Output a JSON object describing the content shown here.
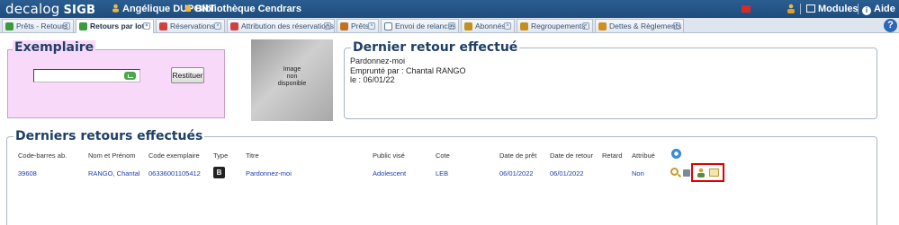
{
  "app": {
    "logo_main": "decalog",
    "logo_brand": "SIGB",
    "user": "Angélique DUPONT",
    "library": "Bibliothèque Cendrars",
    "modules_label": "Modules",
    "help_label": "Aide",
    "help_tab_icon": "?"
  },
  "tabs": [
    {
      "label": "Prêts - Retours",
      "active": false,
      "icon": "loan-icon",
      "color": "#3c9a3c"
    },
    {
      "label": "Retours par lot",
      "active": true,
      "icon": "return-icon",
      "color": "#3c9a3c"
    },
    {
      "label": "Réservations",
      "active": false,
      "icon": "reservation-icon",
      "color": "#d04040"
    },
    {
      "label": "Attribution des réservations",
      "active": false,
      "icon": "assign-icon",
      "color": "#d04040"
    },
    {
      "label": "Prêts",
      "active": false,
      "icon": "books-icon",
      "color": "#c07020"
    },
    {
      "label": "Envoi de relances",
      "active": false,
      "icon": "mail-icon",
      "color": "#5a7aa0"
    },
    {
      "label": "Abonnés",
      "active": false,
      "icon": "users-icon",
      "color": "#c09020"
    },
    {
      "label": "Regroupements",
      "active": false,
      "icon": "group-icon",
      "color": "#c09020"
    },
    {
      "label": "Dettes & Règlements",
      "active": false,
      "icon": "money-icon",
      "color": "#d09020"
    }
  ],
  "exemplaire": {
    "legend": "Exemplaire",
    "input_value": "",
    "restituer_label": "Restituer"
  },
  "no_image": {
    "line1": "Image",
    "line2": "non",
    "line3": "disponible"
  },
  "dernier_retour": {
    "legend": "Dernier retour effectué",
    "title": "Pardonnez-moi",
    "borrower": "Emprunté par : Chantal RANGO",
    "date": "le : 06/01/22"
  },
  "derniers_retours": {
    "legend": "Derniers retours effectués",
    "columns": [
      "Code-barres ab.",
      "Nom et Prénom",
      "Code exemplaire",
      "Type",
      "Titre",
      "Public visé",
      "Cote",
      "Date de prêt",
      "Date de retour",
      "Retard",
      "Attribué"
    ],
    "rows": [
      {
        "barcode": "39608",
        "name": "RANGO, Chantal",
        "item_code": "06336001105412",
        "type": "B",
        "title": "Pardonnez-moi",
        "public": "Adolescent",
        "cote": "LEB",
        "loan_date": "06/01/2022",
        "return_date": "06/01/2022",
        "late": "",
        "assigned": "Non"
      }
    ]
  }
}
